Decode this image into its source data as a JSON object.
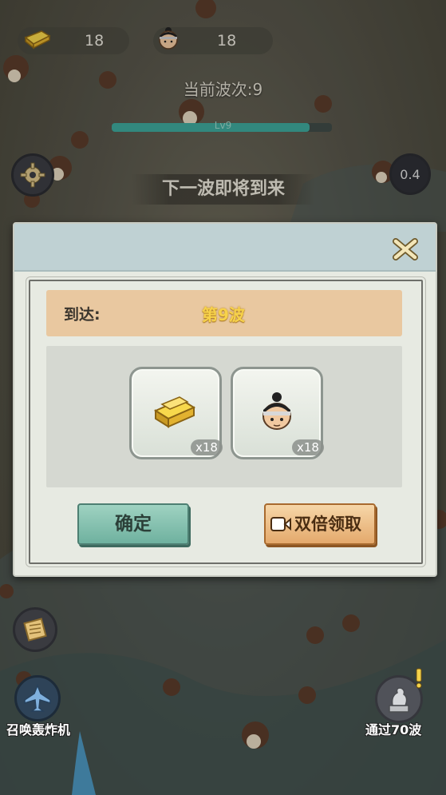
{
  "hud": {
    "gold_count": "18",
    "recruit_count": "18"
  },
  "wave": {
    "current_label": "当前波次:9",
    "level_label": "Lv9",
    "level_progress": 0.9,
    "next_wave_banner": "下一波即将到来",
    "timer": "0.4"
  },
  "dialog": {
    "arrive_label": "到达:",
    "arrive_value": "第9波",
    "rewards": [
      {
        "icon": "gold-bar-icon",
        "qty": "x18"
      },
      {
        "icon": "recruit-head-icon",
        "qty": "x18"
      }
    ],
    "confirm_label": "确定",
    "double_label": "双倍领取"
  },
  "bottom": {
    "summon_label": "召唤轰炸机",
    "pass_label": "通过70波"
  },
  "colors": {
    "dialog_header": "#bfd1d3",
    "arrive_row": "#e9c8a0",
    "confirm_button": "#7fbfae",
    "double_button": "#eebc82",
    "gold_text": "#f7d24a"
  }
}
